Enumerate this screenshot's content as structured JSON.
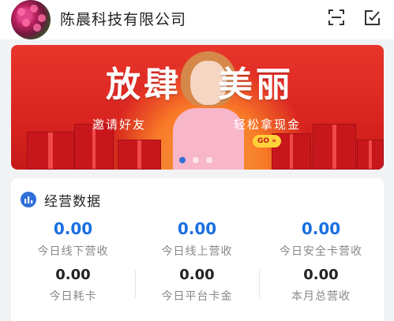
{
  "header": {
    "company_name": "陈晨科技有限公司",
    "icons": [
      "avatar",
      "scan-icon",
      "edit-icon"
    ]
  },
  "banner": {
    "title_left": "放肆",
    "title_right": "美丽",
    "subtitle_left": "邀请好友",
    "subtitle_right": "轻松拿现金",
    "go_label": "GO »",
    "active_slide": 1,
    "slide_count": 3
  },
  "business": {
    "title": "经营数据",
    "stats": [
      {
        "value": "0.00",
        "label": "今日线下营收",
        "highlight": true
      },
      {
        "value": "0.00",
        "label": "今日线上营收",
        "highlight": true
      },
      {
        "value": "0.00",
        "label": "今日安全卡营收",
        "highlight": true
      },
      {
        "value": "0.00",
        "label": "今日耗卡",
        "highlight": false
      },
      {
        "value": "0.00",
        "label": "今日平台卡金",
        "highlight": false
      },
      {
        "value": "0.00",
        "label": "本月总营收",
        "highlight": false
      }
    ]
  },
  "colors": {
    "accent_blue": "#1a6fe0",
    "banner_red": "#d9241f"
  }
}
